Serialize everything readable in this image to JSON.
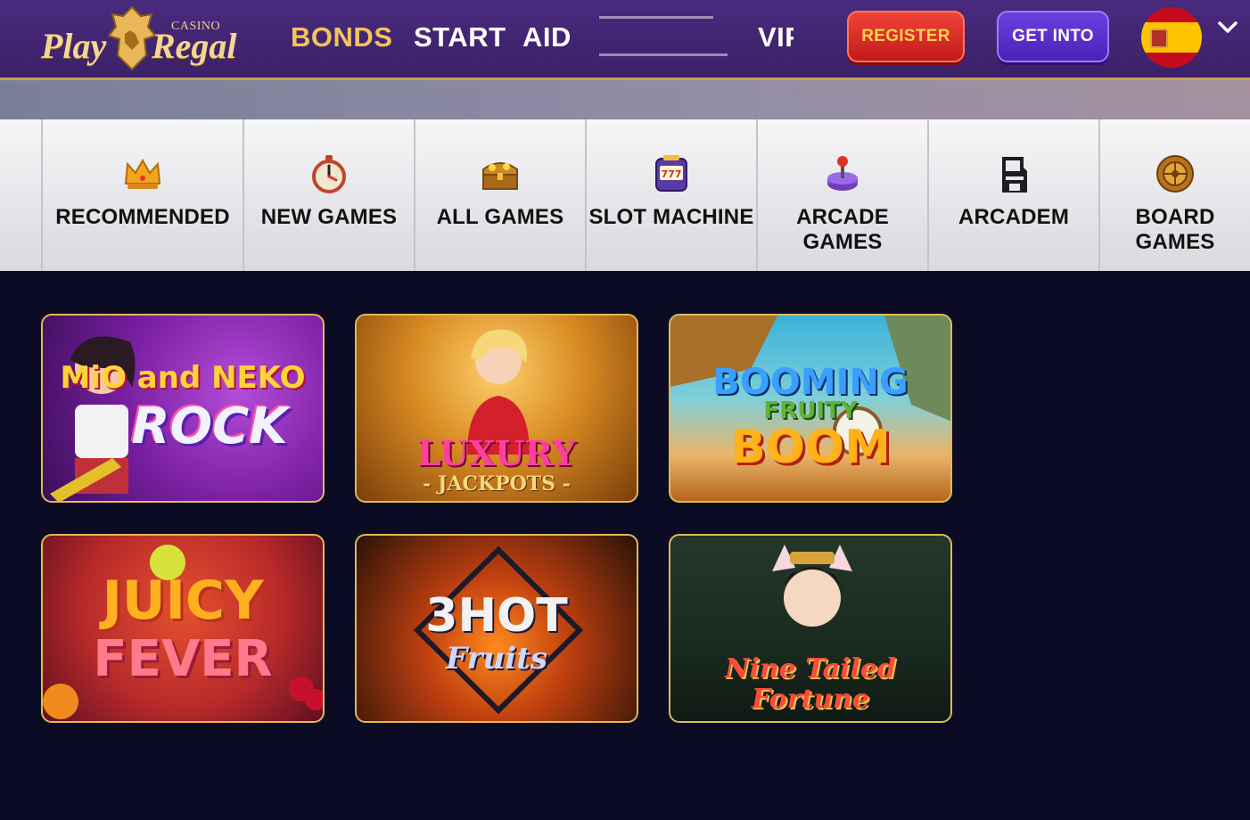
{
  "logo": {
    "top": "CASINO",
    "word1": "Play",
    "word2": "Regal"
  },
  "nav": {
    "bonus": "BONDS",
    "start": "START",
    "aid": "AID",
    "vip": "VIP"
  },
  "buttons": {
    "register": "REGISTER",
    "login": "GET INTO"
  },
  "language": {
    "flag": "spain-flag-icon"
  },
  "categories": [
    {
      "label": "RECOMMENDED",
      "icon": "crown-icon"
    },
    {
      "label": "NEW GAMES",
      "icon": "stopwatch-icon"
    },
    {
      "label": "ALL GAMES",
      "icon": "treasure-chest-icon"
    },
    {
      "label": "SLOT MACHINE",
      "icon": "slot-machine-icon"
    },
    {
      "label": "ARCADE GAMES",
      "icon": "joystick-icon"
    },
    {
      "label": "ARCADEM",
      "icon": "arcade-cabinet-icon"
    },
    {
      "label": "BOARD GAMES",
      "icon": "roulette-icon"
    }
  ],
  "games": [
    {
      "line1": "MiO and NEKO",
      "line2": "ROCK"
    },
    {
      "line1": "LUXURY",
      "line2": "- JACKPOTS -"
    },
    {
      "line1": "BOOMING",
      "line2": "FRUITY",
      "line3": "BOOM"
    },
    {
      "line1": "JUICY",
      "line2": "FEVER"
    },
    {
      "line1": "3HOT",
      "line2": "Fruits"
    },
    {
      "line1": "Nine Tailed",
      "line2": "Fortune"
    }
  ],
  "colors": {
    "header": "#3b2168",
    "gold": "#f3c45b",
    "background": "#0b0c24",
    "register": "#c4191b",
    "login": "#4c22b8"
  }
}
